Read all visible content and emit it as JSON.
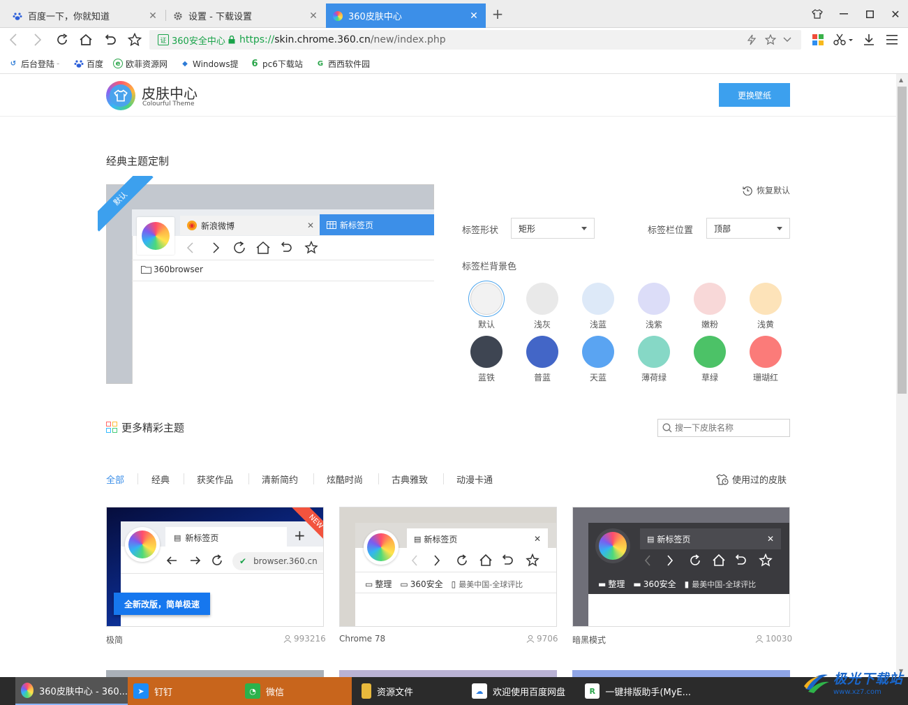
{
  "browser": {
    "tabs": [
      {
        "title": "百度一下，你就知道",
        "icon": "baidu-paw-icon"
      },
      {
        "title": "设置 - 下载设置",
        "icon": "gear-icon"
      },
      {
        "title": "360皮肤中心",
        "icon": "360-skin-icon",
        "active": true
      }
    ],
    "url": {
      "security_label": "360安全中心",
      "scheme": "https://",
      "host": "skin.chrome.360.cn",
      "path": "/new/index.php"
    },
    "bookmarks": [
      {
        "label": "后台登陆"
      },
      {
        "label": "百度"
      },
      {
        "label": "欧菲资源网"
      },
      {
        "label": "Windows提"
      },
      {
        "label": "pc6下载站"
      },
      {
        "label": "西西软件园"
      }
    ]
  },
  "header": {
    "title": "皮肤中心",
    "subtitle": "Colourful Theme",
    "wallpaper_button": "更换壁纸"
  },
  "classic": {
    "title": "经典主题定制",
    "badge": "默认",
    "preview": {
      "tab1": "新浪微博",
      "tab2": "新标签页",
      "folder": "360browser"
    },
    "restore_label": "恢复默认",
    "tab_shape_label": "标签形状",
    "tab_shape_value": "矩形",
    "tab_position_label": "标签栏位置",
    "tab_position_value": "顶部",
    "bg_color_label": "标签栏背景色",
    "colors": [
      {
        "name": "默认",
        "color": "#f2f2f2",
        "selected": true
      },
      {
        "name": "浅灰",
        "color": "#e9e9e9"
      },
      {
        "name": "浅蓝",
        "color": "#dde9f8"
      },
      {
        "name": "浅紫",
        "color": "#dcddf8"
      },
      {
        "name": "嫩粉",
        "color": "#f8d8d8"
      },
      {
        "name": "浅黄",
        "color": "#fde3b9"
      },
      {
        "name": "蓝铁",
        "color": "#3e4552"
      },
      {
        "name": "普蓝",
        "color": "#4366c7"
      },
      {
        "name": "天蓝",
        "color": "#5aa4f2"
      },
      {
        "name": "薄荷绿",
        "color": "#86d8c6"
      },
      {
        "name": "草绿",
        "color": "#4cc267"
      },
      {
        "name": "珊瑚红",
        "color": "#fb7b79"
      }
    ]
  },
  "more": {
    "title": "更多精彩主题",
    "search_placeholder": "搜一下皮肤名称",
    "categories": [
      "全部",
      "经典",
      "获奖作品",
      "清新简约",
      "炫酷时尚",
      "古典雅致",
      "动漫卡通"
    ],
    "used_label": "使用过的皮肤",
    "themes": [
      {
        "name": "极简",
        "count": "993216",
        "tab": "新标签页",
        "url": "browser.360.cn",
        "promo": "全新改版，简单极速",
        "ribbon": "NEW"
      },
      {
        "name": "Chrome 78",
        "count": "9706",
        "tab": "新标签页",
        "bm1": "整理",
        "bm2": "360安全",
        "bm3": "最美中国-全球评比"
      },
      {
        "name": "暗黑模式",
        "count": "10030",
        "tab": "新标签页",
        "bm1": "整理",
        "bm2": "360安全",
        "bm3": "最美中国-全球评比"
      }
    ]
  },
  "taskbar": {
    "items": [
      {
        "label": "360皮肤中心 - 360...",
        "icon": "360-browser-icon"
      },
      {
        "label": "钉钉",
        "icon": "dingtalk-icon"
      },
      {
        "label": "微信",
        "icon": "wechat-icon"
      },
      {
        "label": "资源文件",
        "icon": "folder-icon"
      },
      {
        "label": "欢迎使用百度网盘",
        "icon": "baidu-netdisk-icon"
      },
      {
        "label": "一键排版助手(MyE...",
        "icon": "myeditor-icon"
      }
    ],
    "watermark": {
      "text": "极光下载站",
      "url": "www.xz7.com"
    }
  }
}
